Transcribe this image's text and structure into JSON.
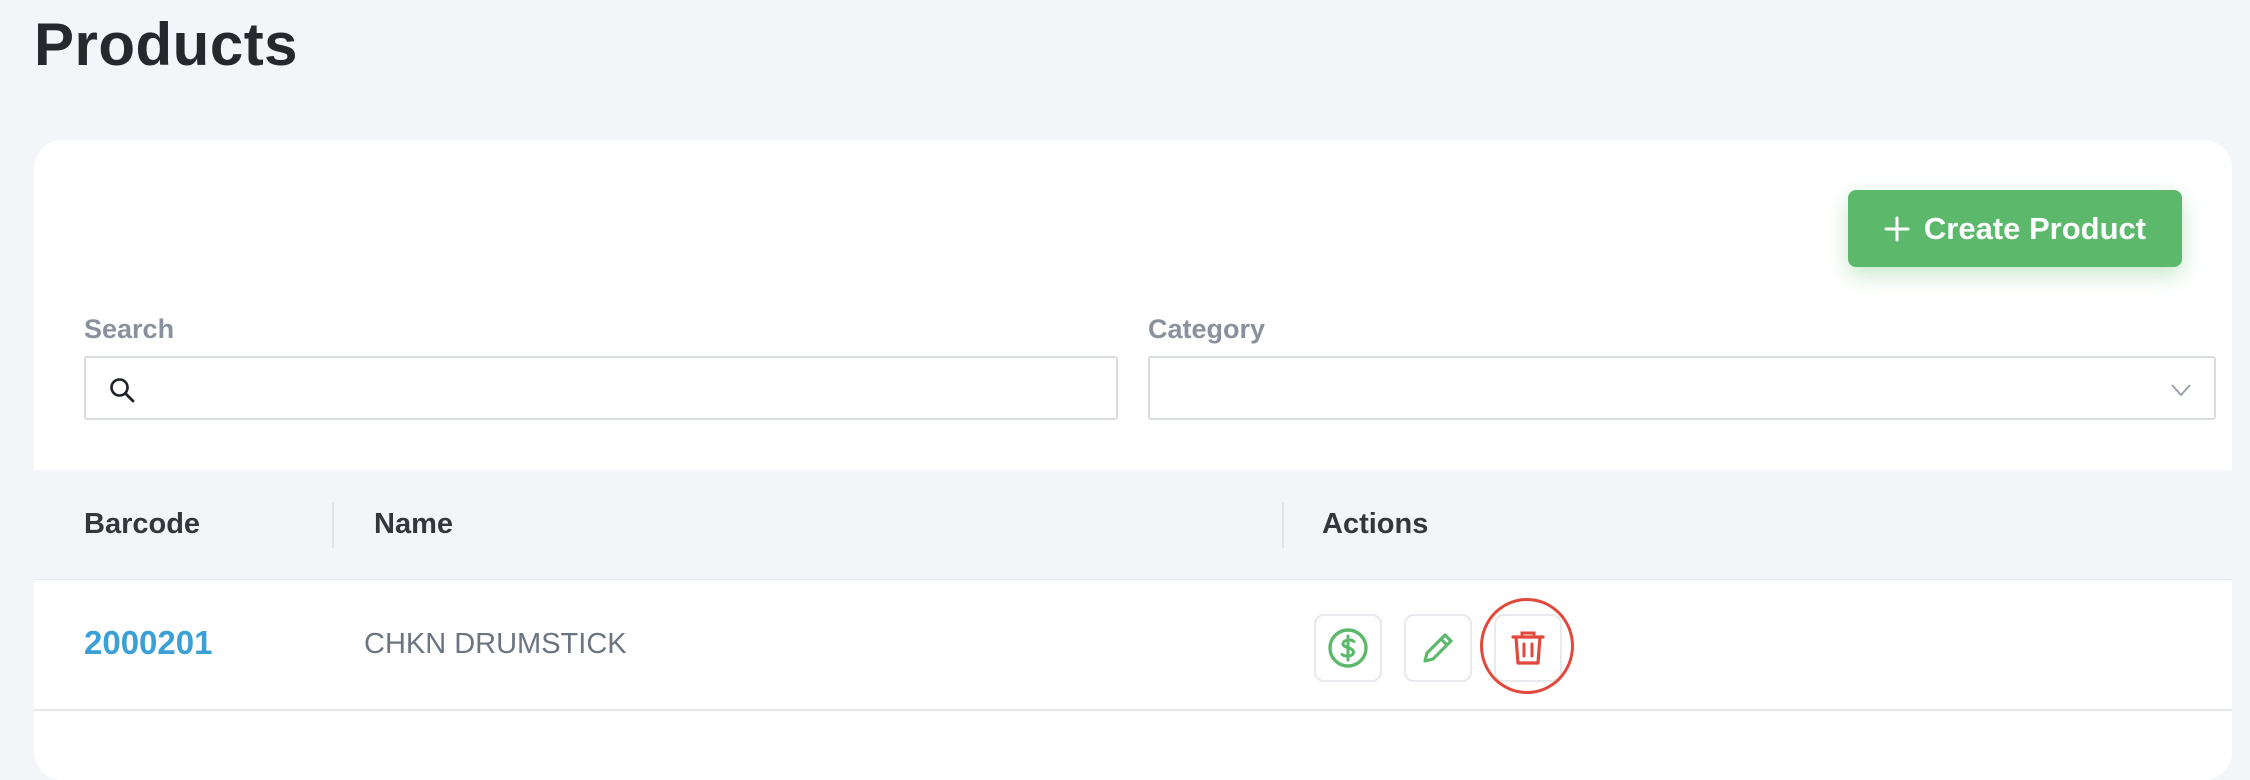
{
  "page": {
    "title": "Products"
  },
  "toolbar": {
    "create_label": "Create Product"
  },
  "filters": {
    "search_label": "Search",
    "search_value": "",
    "category_label": "Category",
    "category_value": ""
  },
  "table": {
    "columns": [
      "Barcode",
      "Name",
      "Actions"
    ],
    "rows": [
      {
        "barcode": "2000201",
        "name": "CHKN DRUMSTICK"
      }
    ]
  },
  "icons": {
    "create": "plus-icon",
    "search": "search-icon",
    "category": "chevron-down-icon",
    "price": "dollar-icon",
    "edit": "pencil-icon",
    "delete": "trash-icon"
  },
  "colors": {
    "primary": "#5cb96b",
    "link": "#3aa0d6",
    "danger": "#e0493b",
    "background": "#f4f5f8"
  }
}
